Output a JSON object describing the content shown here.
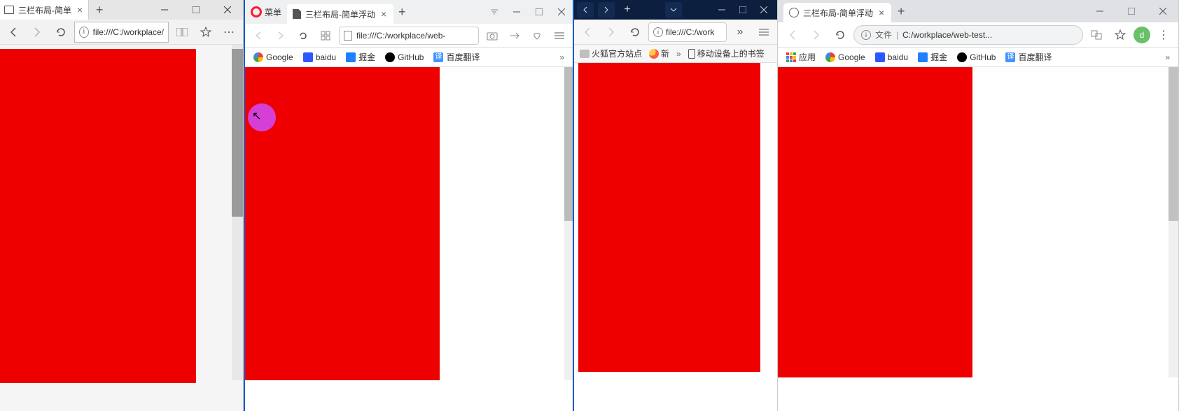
{
  "edge": {
    "tab_title": "三栏布局-简单",
    "url": "file:///C:/workplace/"
  },
  "opera": {
    "menu_label": "菜单",
    "tab_title": "三栏布局-简单浮动",
    "url": "file:///C:/workplace/web-",
    "bookmarks": {
      "google": "Google",
      "baidu": "baidu",
      "juejin": "掘金",
      "github": "GitHub",
      "baidufanyi": "百度翻译"
    }
  },
  "firefox": {
    "url": "file:///C:/work",
    "bookmarks": {
      "official": "火狐官方站点",
      "xin": "新",
      "mobile": "移动设备上的书签"
    }
  },
  "chrome": {
    "tab_title": "三栏布局-简单浮动",
    "url_prefix": "文件",
    "url": "C:/workplace/web-test...",
    "avatar": "d",
    "bookmarks": {
      "apps": "应用",
      "google": "Google",
      "baidu": "baidu",
      "juejin": "掘金",
      "github": "GitHub",
      "baidufanyi": "百度翻译"
    }
  },
  "colors": {
    "content_red": "#e00",
    "cursor_pink": "#d63fd6"
  }
}
